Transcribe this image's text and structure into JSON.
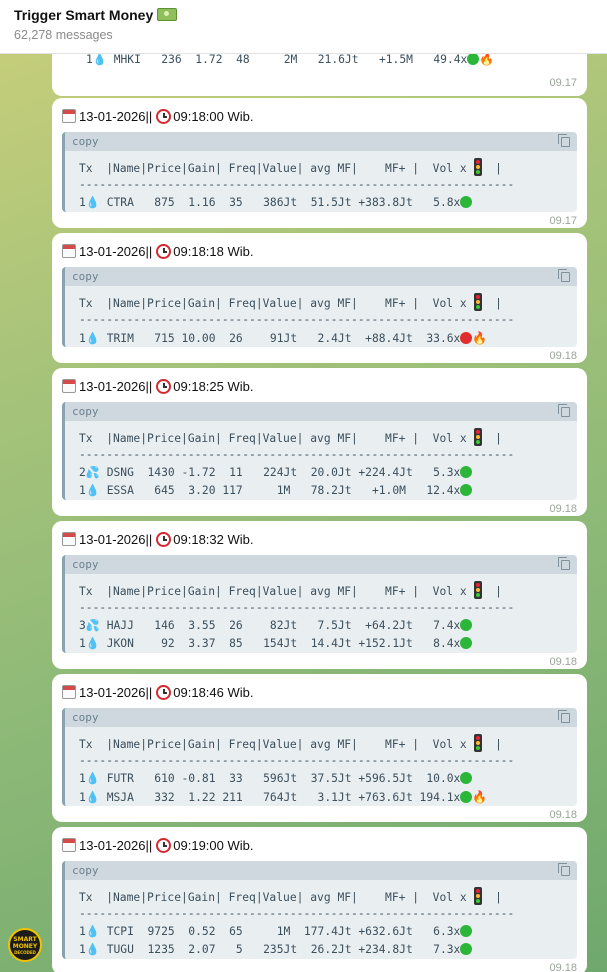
{
  "header": {
    "title": "Trigger Smart Money",
    "subtitle": "62,278 messages"
  },
  "code_lang": "copy",
  "header_row": "Tx  |Name|Price|Gain| Freq|Value| avg MF|    MF+ |  Vol x",
  "divider": "----------------------------------------------------------------",
  "first_row": {
    "count": "1",
    "rest": " MHKI   236  1.72  48     2M   21.6Jt   +1.5M   49.4x",
    "time": "09.17"
  },
  "messages": [
    {
      "date": "13-01-2026",
      "sep": " || ",
      "clock": "09:18:00 Wib.",
      "time": "09.17",
      "rows": [
        {
          "count": "1",
          "rest": " CTRA   875  1.16  35   386Jt  51.5Jt +383.8Jt   5.8x"
        }
      ]
    },
    {
      "date": "13-01-2026",
      "sep": " || ",
      "clock": "09:18:18 Wib.",
      "time": "09.18",
      "rows": [
        {
          "count": "1",
          "rest": " TRIM   715 10.00  26    91Jt   2.4Jt  +88.4Jt  33.6x"
        }
      ]
    },
    {
      "date": "13-01-2026",
      "sep": " || ",
      "clock": "09:18:25 Wib.",
      "time": "09.18",
      "rows": [
        {
          "count": "2",
          "rest": " DSNG  1430 -1.72  11   224Jt  20.0Jt +224.4Jt   5.3x"
        },
        {
          "count": "1",
          "rest": " ESSA   645  3.20 117     1M   78.2Jt   +1.0M   12.4x"
        }
      ]
    },
    {
      "date": "13-01-2026",
      "sep": " || ",
      "clock": "09:18:32 Wib.",
      "time": "09.18",
      "rows": [
        {
          "count": "3",
          "rest": " HAJJ   146  3.55  26    82Jt   7.5Jt  +64.2Jt   7.4x"
        },
        {
          "count": "1",
          "rest": " JKON    92  3.37  85   154Jt  14.4Jt +152.1Jt   8.4x"
        }
      ]
    },
    {
      "date": "13-01-2026",
      "sep": " || ",
      "clock": "09:18:46 Wib.",
      "time": "09.18",
      "rows": [
        {
          "count": "1",
          "rest": " FUTR   610 -0.81  33   596Jt  37.5Jt +596.5Jt  10.0x"
        },
        {
          "count": "1",
          "rest": " MSJA   332  1.22 211   764Jt   3.1Jt +763.6Jt 194.1x"
        }
      ]
    },
    {
      "date": "13-01-2026",
      "sep": " || ",
      "clock": "09:19:00 Wib.",
      "time": "09.18",
      "rows": [
        {
          "count": "1",
          "rest": " TCPI  9725  0.52  65     1M  177.4Jt +632.6Jt   6.3x"
        },
        {
          "count": "1",
          "rest": " TUGU  1235  2.07   5   235Jt  26.2Jt +234.8Jt   7.3x"
        }
      ]
    }
  ],
  "logo": {
    "line1": "SMART",
    "line2": "MONEY",
    "line3": "DECODED"
  },
  "icons": {
    "drop": "droplet-icon",
    "drops": "sweat-droplets-icon",
    "signal_green": "green-circle-icon",
    "signal_red": "red-circle-icon",
    "fire": "fire-icon"
  }
}
